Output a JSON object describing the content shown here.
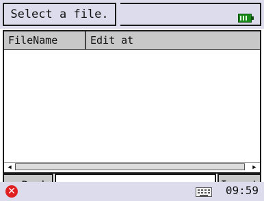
{
  "title": "Select a file.",
  "list": {
    "columns": [
      "FileName",
      "Edit at"
    ],
    "rows": []
  },
  "buttons": {
    "back": "<<Back",
    "import": "Import"
  },
  "status": {
    "time": "09:59"
  },
  "icons": {
    "battery": "battery-full-icon",
    "close": "close-icon",
    "keyboard": "keyboard-icon"
  },
  "colors": {
    "bar_background": "#dcdcec",
    "button_background": "#c8c8c8",
    "battery_green": "#1a8a1a",
    "close_red": "#e02020"
  }
}
